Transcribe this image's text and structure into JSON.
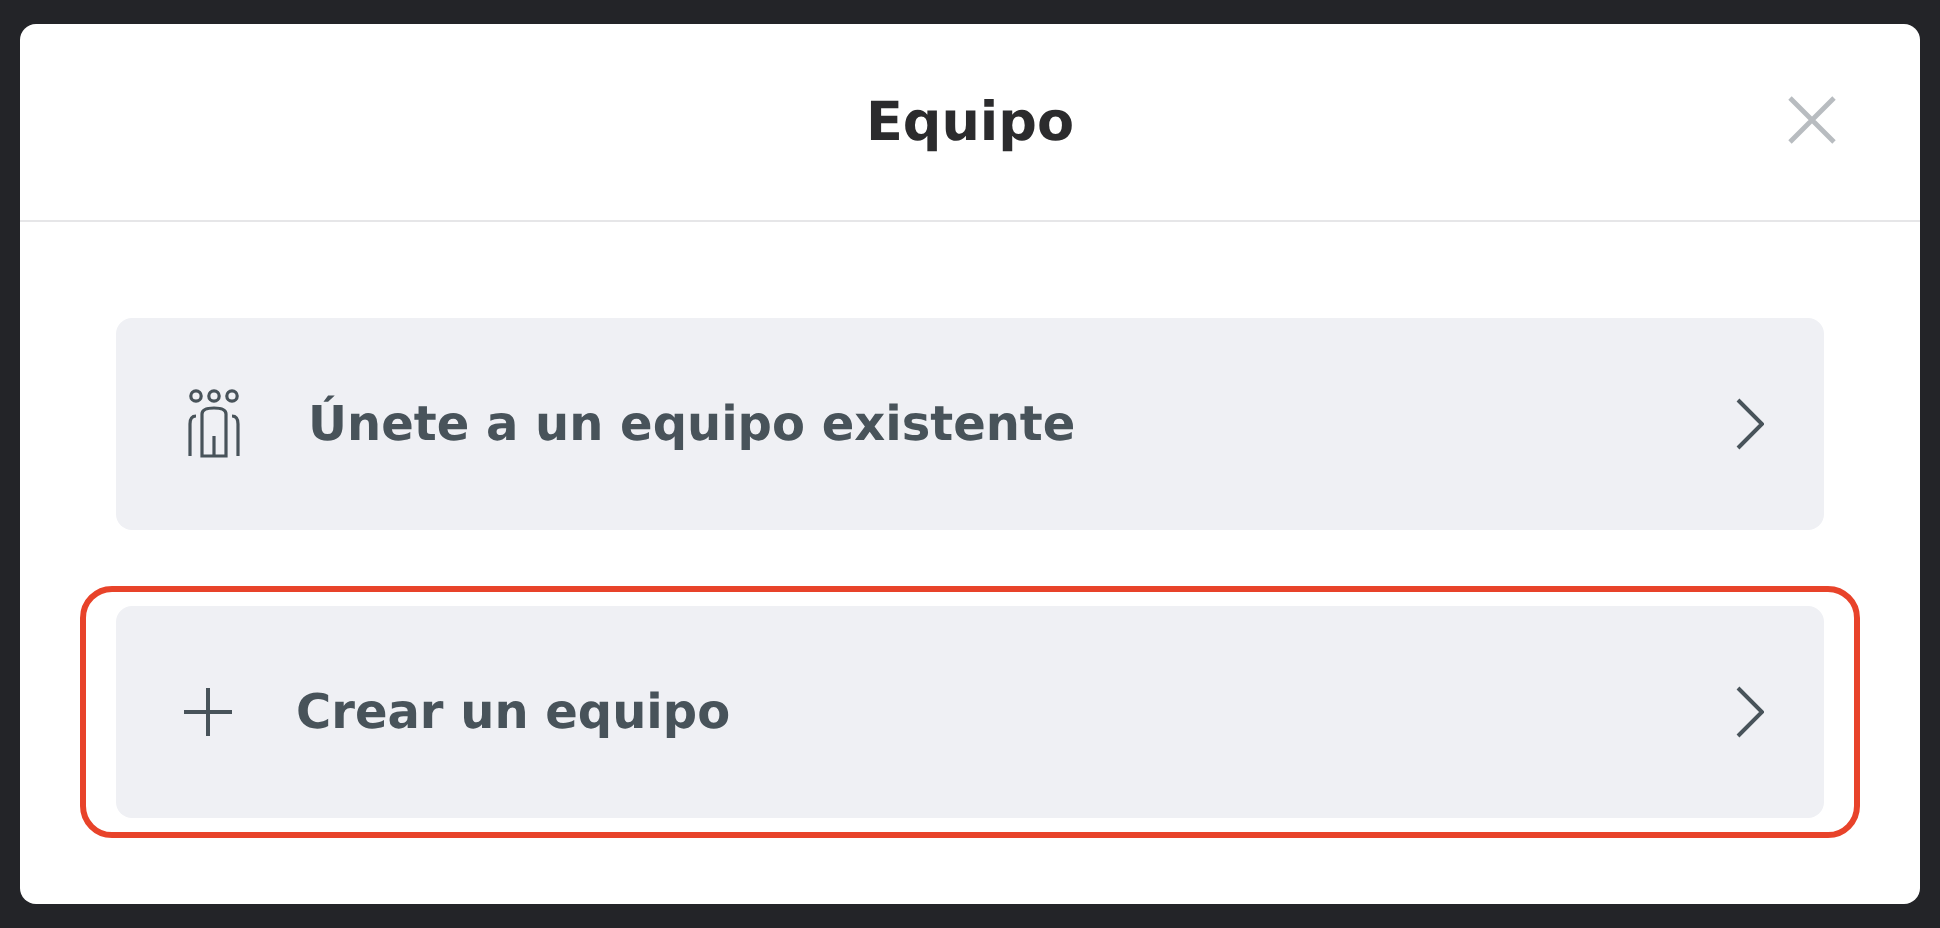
{
  "dialog": {
    "title": "Equipo"
  },
  "options": [
    {
      "kind": "people",
      "label": "Únete a un equipo existente",
      "highlighted": false
    },
    {
      "kind": "plus",
      "label": "Crear un equipo",
      "highlighted": true
    }
  ]
}
